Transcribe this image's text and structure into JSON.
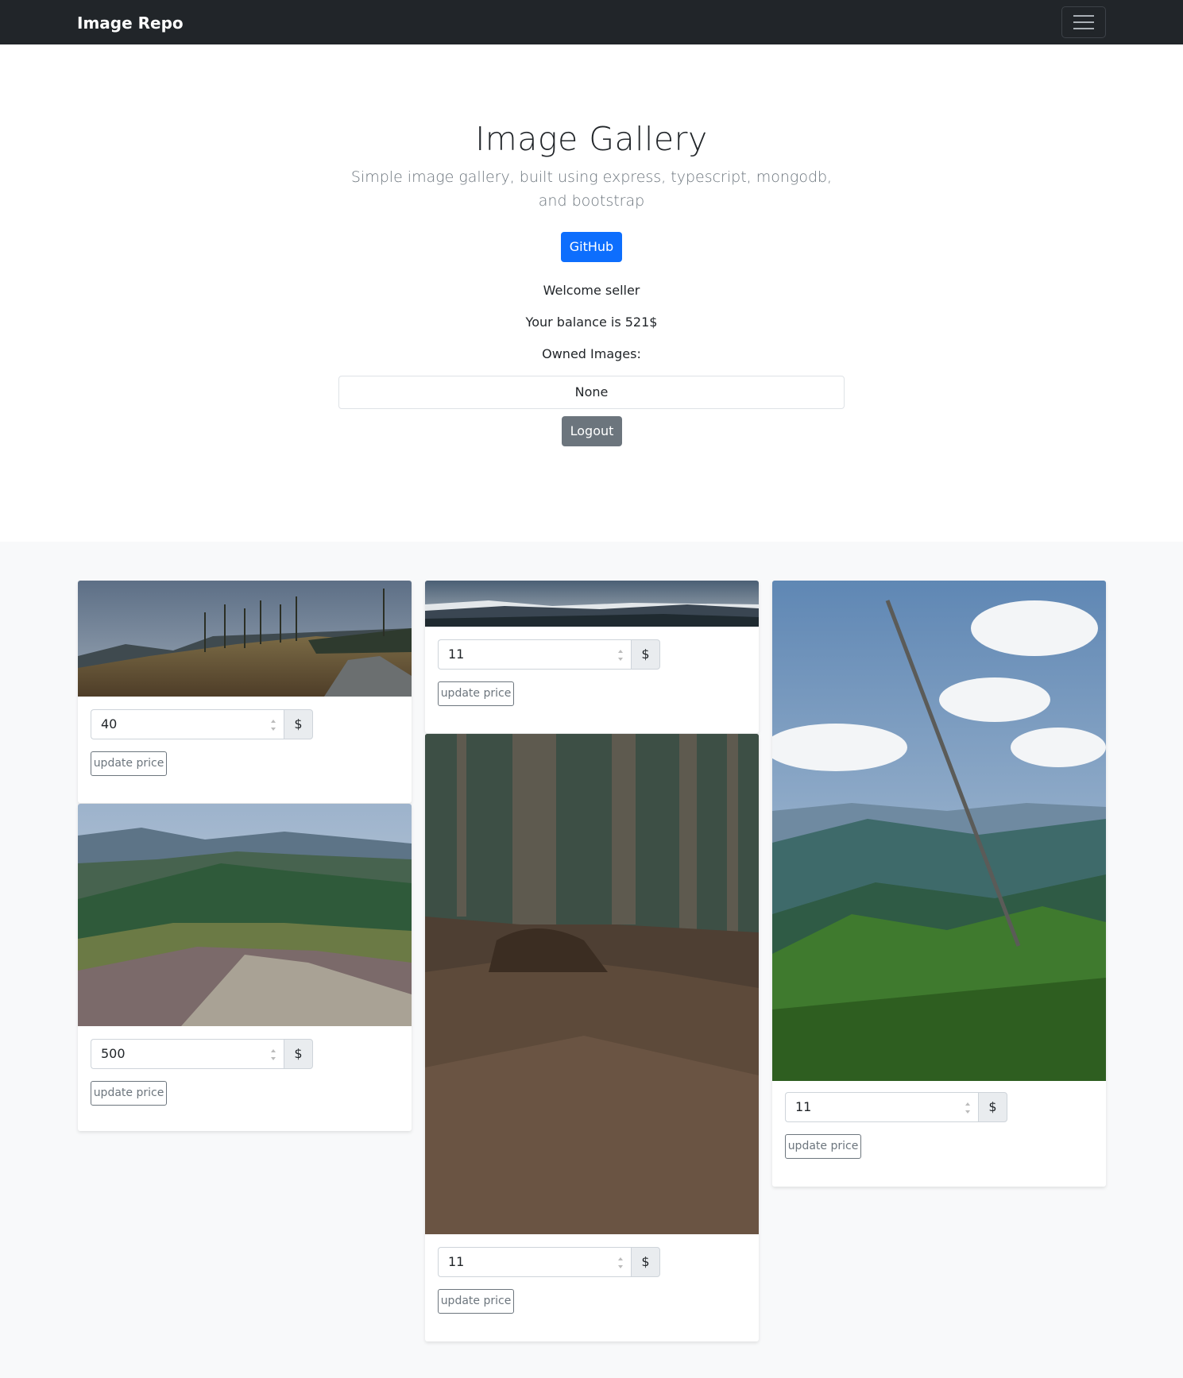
{
  "navbar": {
    "brand": "Image Repo",
    "toggler_icon": "hamburger-icon"
  },
  "hero": {
    "title": "Image Gallery",
    "lead": "Simple image gallery, built using express, typescript, mongodb, and bootstrap",
    "github_label": "GitHub",
    "welcome": "Welcome seller",
    "balance": "Your balance is 521$",
    "owned_label": "Owned Images:",
    "owned_value": "None",
    "logout_label": "Logout"
  },
  "colors": {
    "navbar_bg": "#212529",
    "primary": "#0d6efd",
    "secondary": "#6c757d",
    "gallery_bg": "#f8f9fa"
  },
  "cards": [
    {
      "image_desc": "landscape-clearing",
      "price": "40",
      "currency": "$",
      "update_label": "update price"
    },
    {
      "image_desc": "landscape-mountain-meadow",
      "price": "500",
      "currency": "$",
      "update_label": "update price"
    },
    {
      "image_desc": "landscape-panorama",
      "price": "11",
      "currency": "$",
      "update_label": "update price"
    },
    {
      "image_desc": "forest-trees",
      "price": "11",
      "currency": "$",
      "update_label": "update price"
    },
    {
      "image_desc": "dead-tree-valley",
      "price": "11",
      "currency": "$",
      "update_label": "update price"
    }
  ]
}
